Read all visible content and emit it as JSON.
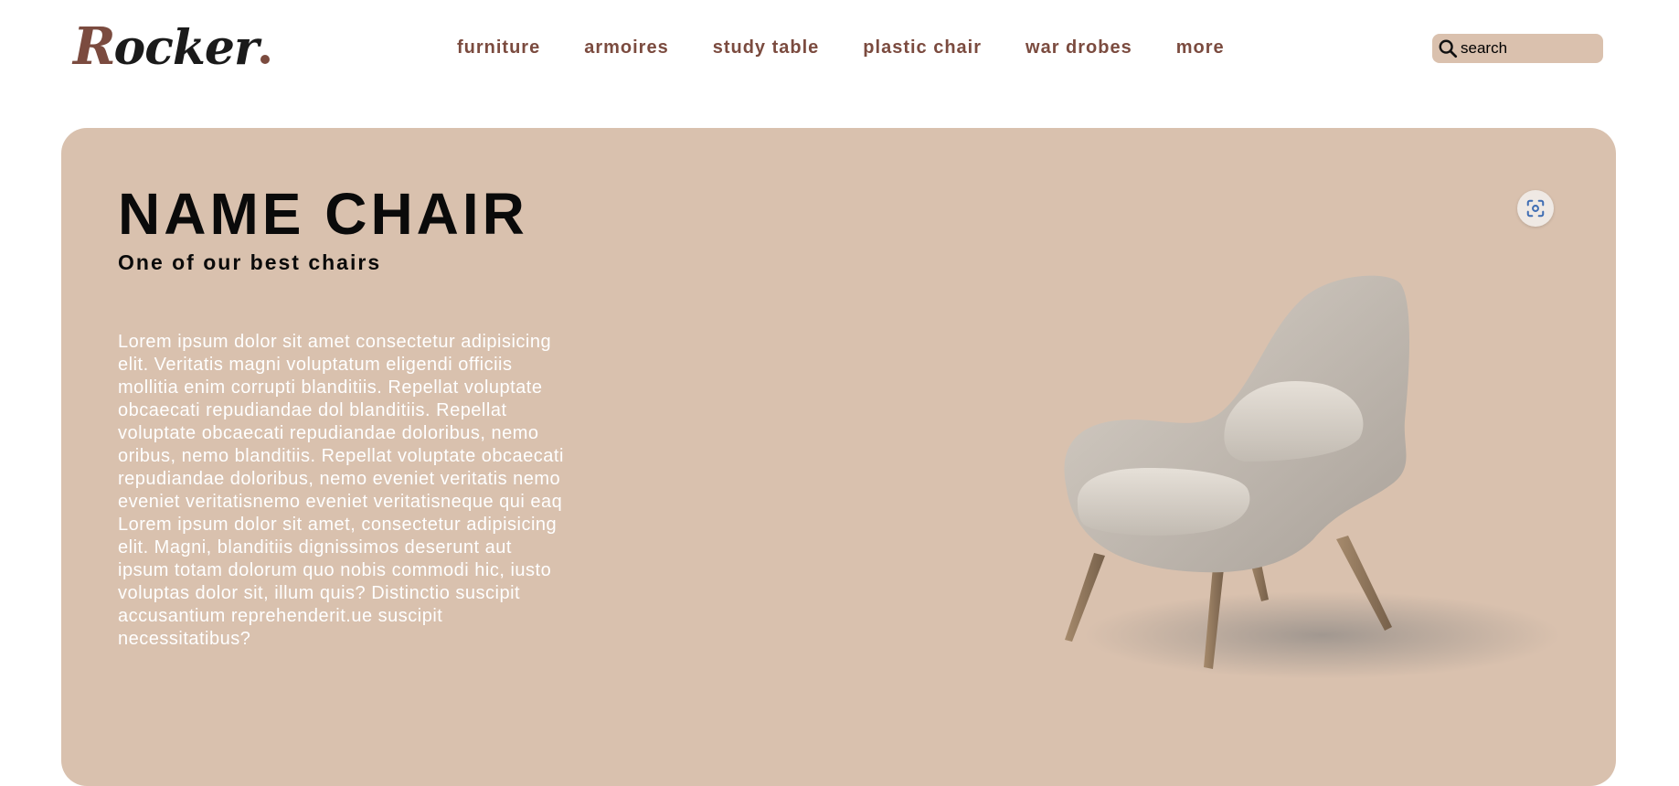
{
  "header": {
    "logo_mark": "R",
    "logo_text": "ocker",
    "nav": [
      {
        "label": "furniture"
      },
      {
        "label": "armoires"
      },
      {
        "label": "study table"
      },
      {
        "label": "plastic chair"
      },
      {
        "label": "war drobes"
      },
      {
        "label": "more"
      }
    ],
    "search": {
      "placeholder": "search",
      "icon": "search-icon"
    }
  },
  "hero": {
    "title": "NAME CHAIR",
    "subtitle": "One of our best chairs",
    "body": "Lorem ipsum dolor sit amet consectetur adipisicing elit. Veritatis magni voluptatum eligendi officiis mollitia enim corrupti blanditiis. Repellat voluptate obcaecati repudiandae dol blanditiis. Repellat voluptate obcaecati repudiandae doloribus, nemo oribus, nemo blanditiis. Repellat voluptate obcaecati repudiandae doloribus, nemo eveniet veritatis nemo eveniet veritatisnemo eveniet veritatisneque qui eaq Lorem ipsum dolor sit amet, consectetur adipisicing elit. Magni, blanditiis dignissimos deserunt aut ipsum totam dolorum quo nobis commodi hic, iusto voluptas dolor sit, illum quis? Distinctio suscipit accusantium reprehenderit.ue suscipit necessitatibus?",
    "image": "lounge-armchair",
    "lens_icon": "visual-search-icon"
  },
  "colors": {
    "brand": "#7b4b3f",
    "hero_bg": "#d9c1ae",
    "search_bg": "#dac1ae",
    "body_text": "#ffffff"
  }
}
